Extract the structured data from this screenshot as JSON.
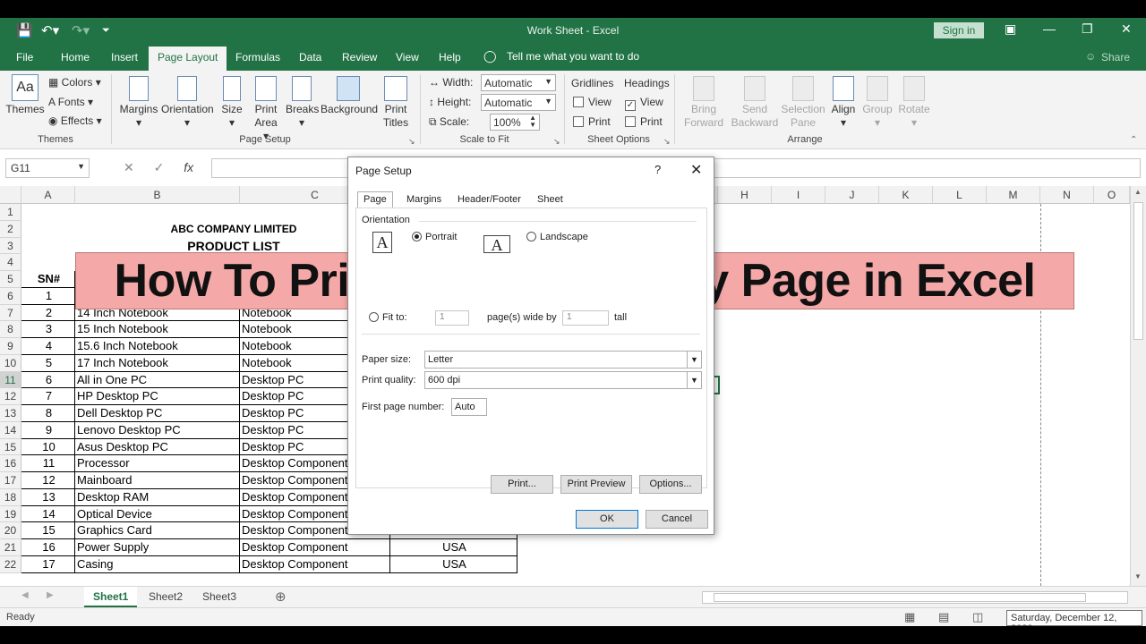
{
  "window": {
    "title": "Work Sheet  -  Excel",
    "signin": "Sign in"
  },
  "ribbon_tabs": [
    {
      "label": "File"
    },
    {
      "label": "Home"
    },
    {
      "label": "Insert"
    },
    {
      "label": "Page Layout"
    },
    {
      "label": "Formulas"
    },
    {
      "label": "Data"
    },
    {
      "label": "Review"
    },
    {
      "label": "View"
    },
    {
      "label": "Help"
    }
  ],
  "tellme": "Tell me what you want to do",
  "share": "Share",
  "ribbon": {
    "themes": {
      "themes": "Themes",
      "colors": "Colors",
      "fonts": "Fonts",
      "effects": "Effects",
      "group": "Themes"
    },
    "page_setup": {
      "margins": "Margins",
      "orientation": "Orientation",
      "size": "Size",
      "print_area": "Print Area",
      "breaks": "Breaks",
      "background": "Background",
      "print_titles": "Print Titles",
      "group": "Page Setup"
    },
    "scale": {
      "width_label": "Width:",
      "width_value": "Automatic",
      "height_label": "Height:",
      "height_value": "Automatic",
      "scale_label": "Scale:",
      "scale_value": "100%",
      "group": "Scale to Fit"
    },
    "sheet_options": {
      "gridlines": "Gridlines",
      "headings": "Headings",
      "view": "View",
      "print": "Print",
      "group": "Sheet Options"
    },
    "arrange": {
      "bring_forward": "Bring Forward",
      "send_backward": "Send Backward",
      "selection_pane": "Selection Pane",
      "align": "Align",
      "group_btn": "Group",
      "rotate": "Rotate",
      "group": "Arrange"
    }
  },
  "formula_bar": {
    "name_box": "G11",
    "fx": "fx"
  },
  "columns": [
    "A",
    "B",
    "C",
    "H",
    "I",
    "J",
    "K",
    "L",
    "M",
    "N",
    "O"
  ],
  "rows": [
    "1",
    "2",
    "3",
    "4",
    "5",
    "6",
    "7",
    "8",
    "9",
    "10",
    "11",
    "12",
    "13",
    "14",
    "15",
    "16",
    "17",
    "18",
    "19",
    "20",
    "21",
    "22"
  ],
  "sheet": {
    "title": "ABC COMPANY LIMITED",
    "subtitle": "PRODUCT LIST",
    "header_sn": "SN#",
    "data": [
      {
        "sn": "1",
        "name": "",
        "cat": "",
        "country": ""
      },
      {
        "sn": "2",
        "name": "14 Inch Notebook",
        "cat": "Notebook",
        "country": ""
      },
      {
        "sn": "3",
        "name": "15 Inch Notebook",
        "cat": "Notebook",
        "country": ""
      },
      {
        "sn": "4",
        "name": "15.6 Inch Notebook",
        "cat": "Notebook",
        "country": ""
      },
      {
        "sn": "5",
        "name": "17 Inch Notebook",
        "cat": "Notebook",
        "country": ""
      },
      {
        "sn": "6",
        "name": "All in One PC",
        "cat": "Desktop PC",
        "country": ""
      },
      {
        "sn": "7",
        "name": "HP Desktop PC",
        "cat": "Desktop PC",
        "country": ""
      },
      {
        "sn": "8",
        "name": "Dell Desktop PC",
        "cat": "Desktop PC",
        "country": ""
      },
      {
        "sn": "9",
        "name": "Lenovo Desktop PC",
        "cat": "Desktop PC",
        "country": ""
      },
      {
        "sn": "10",
        "name": "Asus Desktop PC",
        "cat": "Desktop PC",
        "country": ""
      },
      {
        "sn": "11",
        "name": "Processor",
        "cat": "Desktop Component",
        "country": ""
      },
      {
        "sn": "12",
        "name": "Mainboard",
        "cat": "Desktop Component",
        "country": ""
      },
      {
        "sn": "13",
        "name": "Desktop RAM",
        "cat": "Desktop Component",
        "country": ""
      },
      {
        "sn": "14",
        "name": "Optical Device",
        "cat": "Desktop Component",
        "country": ""
      },
      {
        "sn": "15",
        "name": "Graphics Card",
        "cat": "Desktop Component",
        "country": "USA"
      },
      {
        "sn": "16",
        "name": "Power Supply",
        "cat": "Desktop Component",
        "country": "USA"
      },
      {
        "sn": "17",
        "name": "Casing",
        "cat": "Desktop Component",
        "country": "USA"
      }
    ]
  },
  "banner": "How To Print Titles on Every Page in Excel",
  "dialog": {
    "title": "Page Setup",
    "help": "?",
    "tabs": [
      "Page",
      "Margins",
      "Header/Footer",
      "Sheet"
    ],
    "orientation_label": "Orientation",
    "portrait": "Portrait",
    "landscape": "Landscape",
    "fit_to": "Fit to:",
    "fit_wide_value": "1",
    "fit_wide_label": "page(s) wide by",
    "fit_tall_value": "1",
    "fit_tall_label": "tall",
    "paper_size_label": "Paper size:",
    "paper_size_value": "Letter",
    "print_quality_label": "Print quality:",
    "print_quality_value": "600 dpi",
    "first_page_label": "First page number:",
    "first_page_value": "Auto",
    "print_btn": "Print...",
    "preview_btn": "Print Preview",
    "options_btn": "Options...",
    "ok_btn": "OK",
    "cancel_btn": "Cancel"
  },
  "sheet_tabs": [
    "Sheet1",
    "Sheet2",
    "Sheet3"
  ],
  "status": {
    "ready": "Ready",
    "date": "Saturday, December 12, 2020"
  },
  "colors": {
    "accent": "#217346",
    "banner": "#f4a9a8"
  }
}
